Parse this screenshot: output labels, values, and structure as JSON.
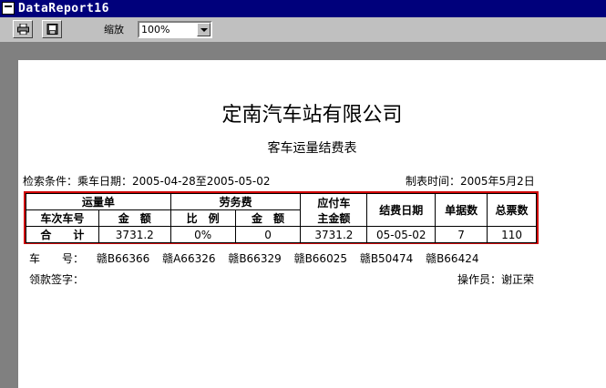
{
  "window": {
    "title": "DataReport16"
  },
  "toolbar": {
    "print_icon": "printer-icon",
    "export_icon": "export-icon",
    "zoom_label": "缩放",
    "zoom_value": "100%"
  },
  "report": {
    "company": "定南汽车站有限公司",
    "subtitle": "客车运量结费表",
    "condition": "检索条件：乘车日期：2005-04-28至2005-05-02",
    "made_time": "制表时间：2005年5月2日",
    "table": {
      "group_waybill": "运量单",
      "group_service_fee": "劳务费",
      "col_payable": "应付车主金额",
      "col_payable_l1": "应付车",
      "col_payable_l2": "主金额",
      "col_settle_date": "结费日期",
      "col_doc_count": "单据数",
      "col_total_tickets": "总票数",
      "sub_trip": "车次车号",
      "sub_amount": "金　额",
      "sub_ratio": "比　例",
      "sub_fee_amount": "金　额",
      "total_label": "合　　计",
      "total_amount": "3731.2",
      "total_ratio": "0%",
      "total_fee": "0",
      "total_payable": "3731.2",
      "total_settle_date": "05-05-02",
      "total_doc_count": "7",
      "total_tickets": "110"
    },
    "plates_label": "车　　号：",
    "plates": [
      "赣B66366",
      "赣A66326",
      "赣B66329",
      "赣B66025",
      "赣B50474",
      "赣B66424"
    ],
    "sign_label": "领款签字：",
    "operator": "操作员：谢正荣"
  }
}
